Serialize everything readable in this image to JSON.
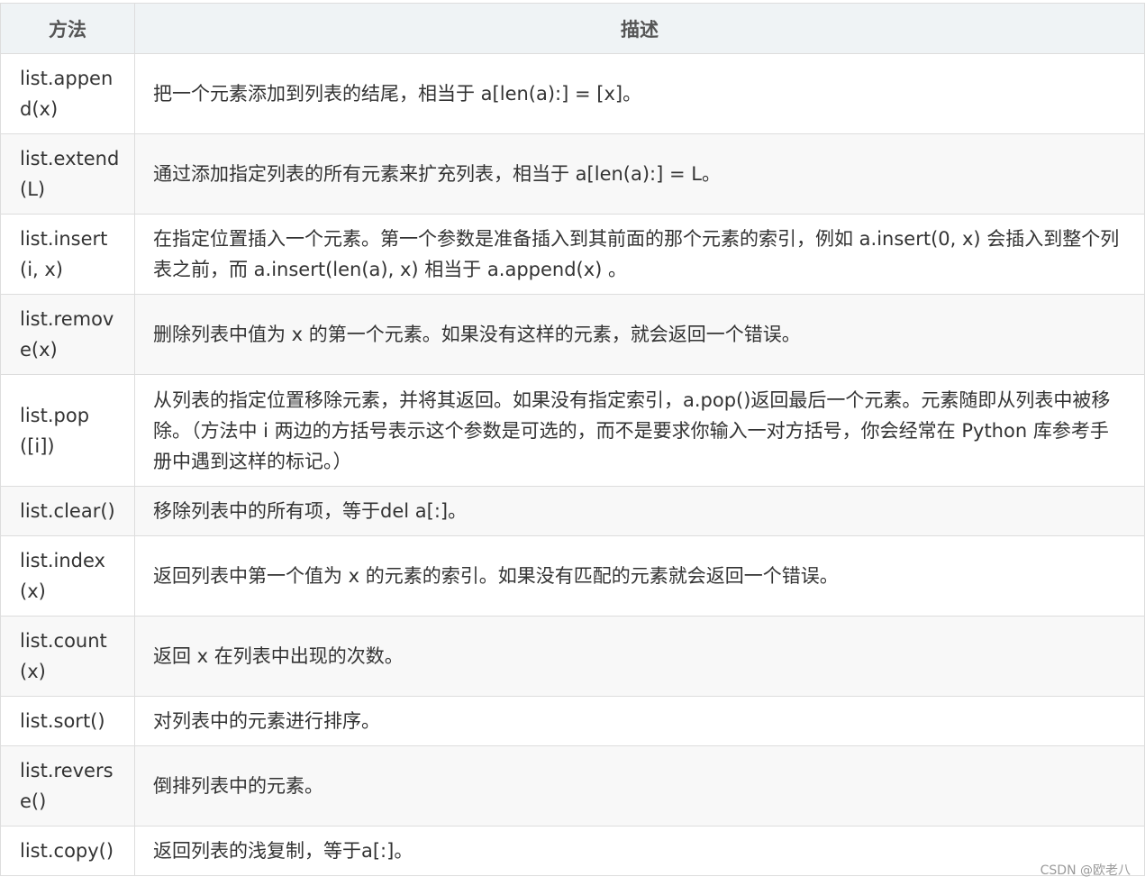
{
  "headers": {
    "method": "方法",
    "description": "描述"
  },
  "rows": [
    {
      "method": "list.append(x)",
      "description": "把一个元素添加到列表的结尾，相当于 a[len(a):] = [x]。"
    },
    {
      "method": "list.extend(L)",
      "description": "通过添加指定列表的所有元素来扩充列表，相当于 a[len(a):] = L。"
    },
    {
      "method": "list.insert(i, x)",
      "description": "在指定位置插入一个元素。第一个参数是准备插入到其前面的那个元素的索引，例如 a.insert(0, x) 会插入到整个列表之前，而 a.insert(len(a), x) 相当于 a.append(x) 。"
    },
    {
      "method": "list.remove(x)",
      "description": "删除列表中值为 x 的第一个元素。如果没有这样的元素，就会返回一个错误。"
    },
    {
      "method": "list.pop([i])",
      "description": "从列表的指定位置移除元素，并将其返回。如果没有指定索引，a.pop()返回最后一个元素。元素随即从列表中被移除。（方法中 i 两边的方括号表示这个参数是可选的，而不是要求你输入一对方括号，你会经常在 Python 库参考手册中遇到这样的标记。）"
    },
    {
      "method": "list.clear()",
      "description": "移除列表中的所有项，等于del a[:]。"
    },
    {
      "method": "list.index(x)",
      "description": "返回列表中第一个值为 x 的元素的索引。如果没有匹配的元素就会返回一个错误。"
    },
    {
      "method": "list.count(x)",
      "description": "返回 x 在列表中出现的次数。"
    },
    {
      "method": "list.sort()",
      "description": "对列表中的元素进行排序。"
    },
    {
      "method": "list.reverse()",
      "description": "倒排列表中的元素。"
    },
    {
      "method": "list.copy()",
      "description": "返回列表的浅复制，等于a[:]。"
    }
  ],
  "watermark": "CSDN @欧老八"
}
